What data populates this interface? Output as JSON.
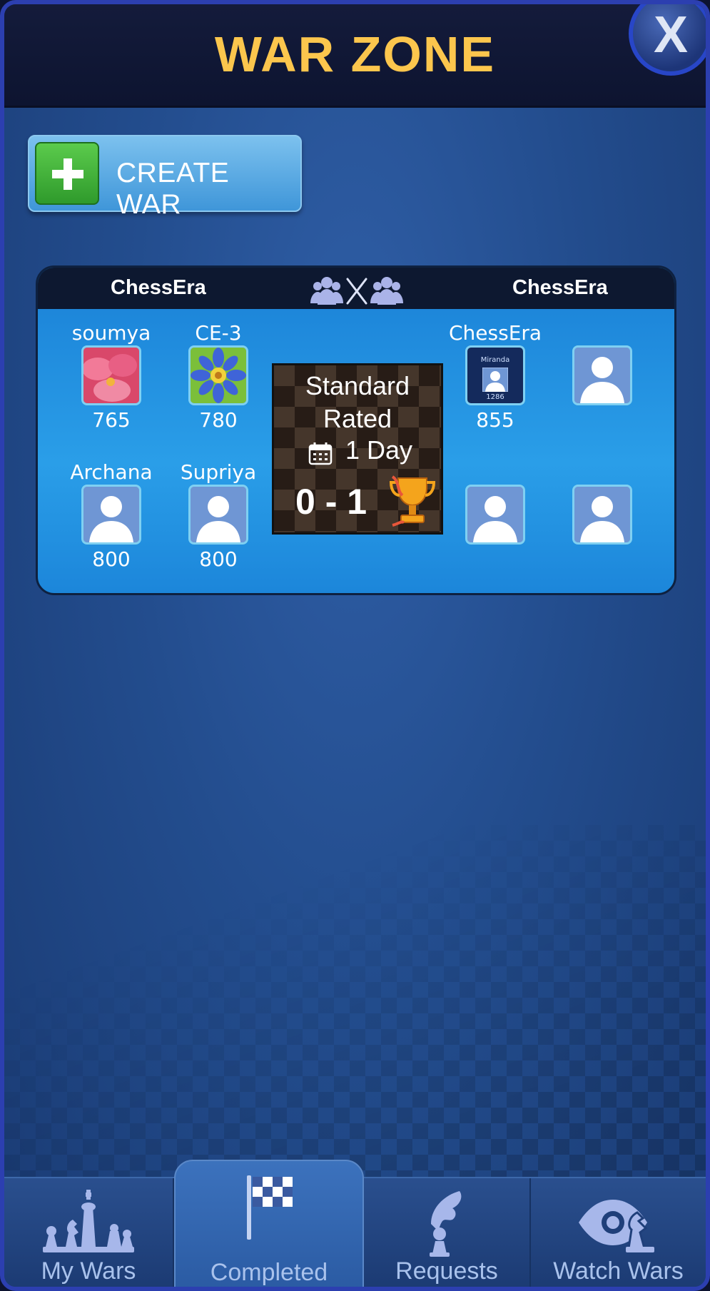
{
  "header": {
    "title": "WAR ZONE",
    "close_label": "X"
  },
  "create_button": {
    "label": "CREATE WAR"
  },
  "war": {
    "team_left": "ChessEra",
    "team_right": "ChessEra",
    "left_players": [
      {
        "name": "soumya",
        "rating": "765"
      },
      {
        "name": "CE-3",
        "rating": "780"
      },
      {
        "name": "Archana",
        "rating": "800"
      },
      {
        "name": "Supriya",
        "rating": "800"
      }
    ],
    "right_players": [
      {
        "name": "ChessEra",
        "rating": "855",
        "card_name": "Miranda",
        "card_rating": "1286"
      }
    ],
    "game_type": "Standard",
    "rated": "Rated",
    "duration": "1 Day",
    "score": "0 - 1"
  },
  "tabs": [
    {
      "label": "My Wars",
      "icon": "chess-pieces-icon"
    },
    {
      "label": "Completed",
      "icon": "checkered-flag-icon",
      "active": true
    },
    {
      "label": "Requests",
      "icon": "hand-pawn-icon"
    },
    {
      "label": "Watch Wars",
      "icon": "eye-knight-icon"
    }
  ]
}
